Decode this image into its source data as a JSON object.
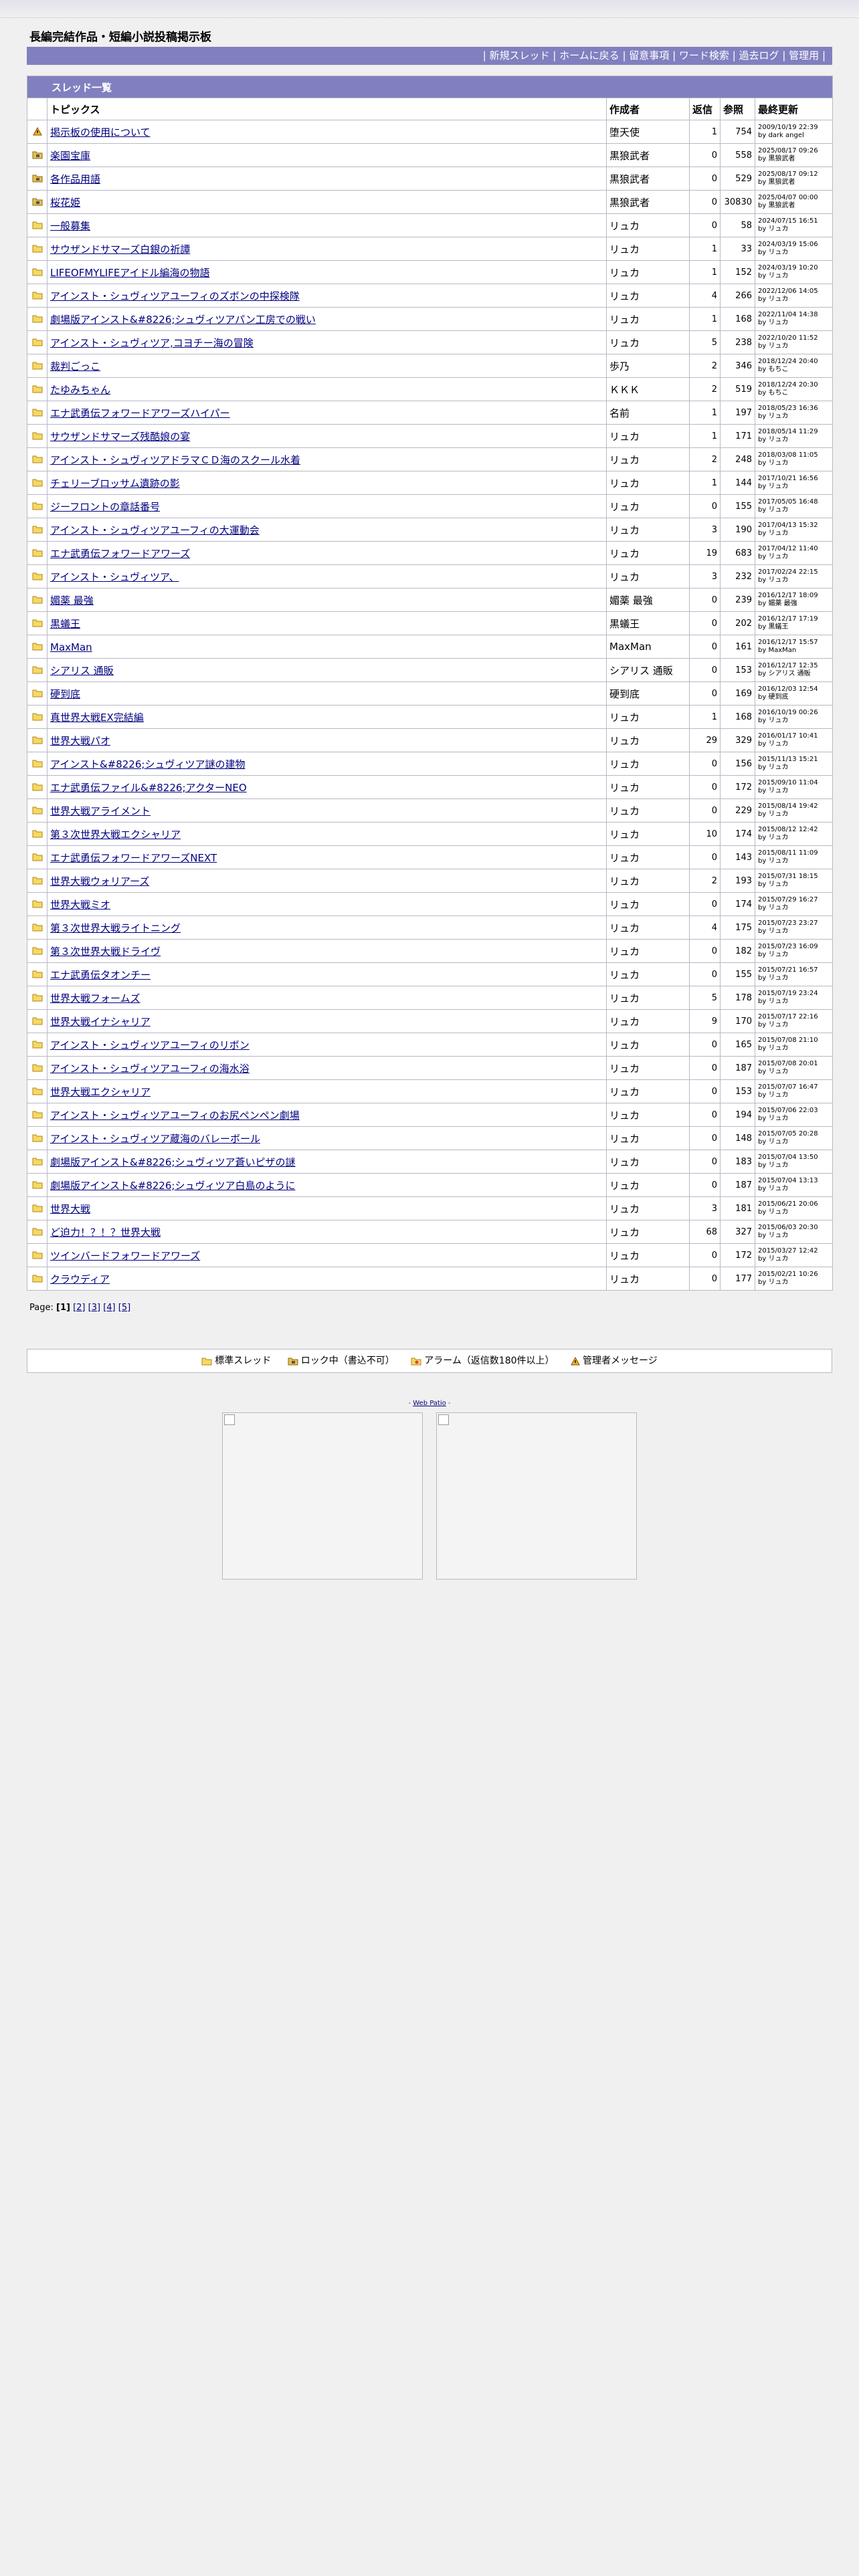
{
  "site": {
    "title": "長編完結作品・短編小説投稿掲示板",
    "menu": [
      "新規スレッド",
      "ホームに戻る",
      "留意事項",
      "ワード検索",
      "過去ログ",
      "管理用"
    ]
  },
  "table": {
    "caption": "スレッド一覧",
    "headers": [
      "トピックス",
      "作成者",
      "返信",
      "参照",
      "最終更新"
    ],
    "rows": [
      {
        "icon": "warning",
        "topic": "掲示板の使用について",
        "author": "堕天使",
        "replies": "1",
        "views": "754",
        "updated": "2009/10/19 22:39",
        "by": "by dark angel"
      },
      {
        "icon": "lock",
        "topic": "楽園宝庫",
        "author": "黒狼武者",
        "replies": "0",
        "views": "558",
        "updated": "2025/08/17 09:26",
        "by": "by 黒狼武者"
      },
      {
        "icon": "lock",
        "topic": "各作品用語",
        "author": "黒狼武者",
        "replies": "0",
        "views": "529",
        "updated": "2025/08/17 09:12",
        "by": "by 黒狼武者"
      },
      {
        "icon": "lock",
        "topic": "桜花姫",
        "author": "黒狼武者",
        "replies": "0",
        "views": "30830",
        "updated": "2025/04/07 00:00",
        "by": "by 黒狼武者"
      },
      {
        "icon": "folder",
        "topic": "一般募集",
        "author": "リュカ",
        "replies": "0",
        "views": "58",
        "updated": "2024/07/15 16:51",
        "by": "by リュカ"
      },
      {
        "icon": "folder",
        "topic": "サウザンドサマーズ白銀の祈譚",
        "author": "リュカ",
        "replies": "1",
        "views": "33",
        "updated": "2024/03/19 15:06",
        "by": "by リュカ"
      },
      {
        "icon": "folder",
        "topic": "LIFEOFMYLIFEアイドル編海の物語",
        "author": "リュカ",
        "replies": "1",
        "views": "152",
        "updated": "2024/03/19 10:20",
        "by": "by リュカ"
      },
      {
        "icon": "folder",
        "topic": "アインスト・シュヴィツアユーフィのズボンの中探検隊",
        "author": "リュカ",
        "replies": "4",
        "views": "266",
        "updated": "2022/12/06 14:05",
        "by": "by リュカ"
      },
      {
        "icon": "folder",
        "topic": "劇場版アインスト&#8226;シュヴィツアパン工房での戦い",
        "author": "リュカ",
        "replies": "1",
        "views": "168",
        "updated": "2022/11/04 14:38",
        "by": "by リュカ"
      },
      {
        "icon": "folder",
        "topic": "アインスト・シュヴィツア,コヨチー海の冒険",
        "author": "リュカ",
        "replies": "5",
        "views": "238",
        "updated": "2022/10/20 11:52",
        "by": "by リュカ"
      },
      {
        "icon": "folder",
        "topic": "裁判ごっこ",
        "author": "歩乃",
        "replies": "2",
        "views": "346",
        "updated": "2018/12/24 20:40",
        "by": "by もちこ"
      },
      {
        "icon": "folder",
        "topic": "たゆみちゃん",
        "author": "ＫＫＫ",
        "replies": "2",
        "views": "519",
        "updated": "2018/12/24 20:30",
        "by": "by もちこ"
      },
      {
        "icon": "folder",
        "topic": "エナ武勇伝フォワードアワーズハイパー",
        "author": "名前",
        "replies": "1",
        "views": "197",
        "updated": "2018/05/23 16:36",
        "by": "by リュカ"
      },
      {
        "icon": "folder",
        "topic": "サウザンドサマーズ残酷娘の宴",
        "author": "リュカ",
        "replies": "1",
        "views": "171",
        "updated": "2018/05/14 11:29",
        "by": "by リュカ"
      },
      {
        "icon": "folder",
        "topic": "アインスト・シュヴィツアドラマＣＤ海のスクール水着",
        "author": "リュカ",
        "replies": "2",
        "views": "248",
        "updated": "2018/03/08 11:05",
        "by": "by リュカ"
      },
      {
        "icon": "folder",
        "topic": "チェリーブロッサム遺跡の影",
        "author": "リュカ",
        "replies": "1",
        "views": "144",
        "updated": "2017/10/21 16:56",
        "by": "by リュカ"
      },
      {
        "icon": "folder",
        "topic": "ジーフロントの章話番号",
        "author": "リュカ",
        "replies": "0",
        "views": "155",
        "updated": "2017/05/05 16:48",
        "by": "by リュカ"
      },
      {
        "icon": "folder",
        "topic": "アインスト・シュヴィツアユーフィの大運動会",
        "author": "リュカ",
        "replies": "3",
        "views": "190",
        "updated": "2017/04/13 15:32",
        "by": "by リュカ"
      },
      {
        "icon": "folder",
        "topic": "エナ武勇伝フォワードアワーズ",
        "author": "リュカ",
        "replies": "19",
        "views": "683",
        "updated": "2017/04/12 11:40",
        "by": "by リュカ"
      },
      {
        "icon": "folder",
        "topic": "アインスト・シュヴィツア、",
        "author": "リュカ",
        "replies": "3",
        "views": "232",
        "updated": "2017/02/24 22:15",
        "by": "by リュカ"
      },
      {
        "icon": "folder",
        "topic": "媚薬 最強",
        "author": "媚薬 最強",
        "replies": "0",
        "views": "239",
        "updated": "2016/12/17 18:09",
        "by": "by 媚薬 最強"
      },
      {
        "icon": "folder",
        "topic": "黒蟻王",
        "author": "黒蟻王",
        "replies": "0",
        "views": "202",
        "updated": "2016/12/17 17:19",
        "by": "by 黒蟻王"
      },
      {
        "icon": "folder",
        "topic": "MaxMan",
        "author": "MaxMan",
        "replies": "0",
        "views": "161",
        "updated": "2016/12/17 15:57",
        "by": "by MaxMan"
      },
      {
        "icon": "folder",
        "topic": "シアリス 通販",
        "author": "シアリス 通販",
        "replies": "0",
        "views": "153",
        "updated": "2016/12/17 12:35",
        "by": "by シアリス 通販"
      },
      {
        "icon": "folder",
        "topic": "硬到底",
        "author": "硬到底",
        "replies": "0",
        "views": "169",
        "updated": "2016/12/03 12:54",
        "by": "by 硬到底"
      },
      {
        "icon": "folder",
        "topic": "真世界大戦EX完結編",
        "author": "リュカ",
        "replies": "1",
        "views": "168",
        "updated": "2016/10/19 00:26",
        "by": "by リュカ"
      },
      {
        "icon": "folder",
        "topic": "世界大戦パオ",
        "author": "リュカ",
        "replies": "29",
        "views": "329",
        "updated": "2016/01/17 10:41",
        "by": "by リュカ"
      },
      {
        "icon": "folder",
        "topic": "アインスト&#8226;シュヴィツア謎の建物",
        "author": "リュカ",
        "replies": "0",
        "views": "156",
        "updated": "2015/11/13 15:21",
        "by": "by リュカ"
      },
      {
        "icon": "folder",
        "topic": "エナ武勇伝ファイル&#8226;アクターNEO",
        "author": "リュカ",
        "replies": "0",
        "views": "172",
        "updated": "2015/09/10 11:04",
        "by": "by リュカ"
      },
      {
        "icon": "folder",
        "topic": "世界大戦アライメント",
        "author": "リュカ",
        "replies": "0",
        "views": "229",
        "updated": "2015/08/14 19:42",
        "by": "by リュカ"
      },
      {
        "icon": "folder",
        "topic": "第３次世界大戦エクシャリア",
        "author": "リュカ",
        "replies": "10",
        "views": "174",
        "updated": "2015/08/12 12:42",
        "by": "by リュカ"
      },
      {
        "icon": "folder",
        "topic": "エナ武勇伝フォワードアワーズNEXT",
        "author": "リュカ",
        "replies": "0",
        "views": "143",
        "updated": "2015/08/11 11:09",
        "by": "by リュカ"
      },
      {
        "icon": "folder",
        "topic": "世界大戦ウォリアーズ",
        "author": "リュカ",
        "replies": "2",
        "views": "193",
        "updated": "2015/07/31 18:15",
        "by": "by リュカ"
      },
      {
        "icon": "folder",
        "topic": "世界大戦ミオ",
        "author": "リュカ",
        "replies": "0",
        "views": "174",
        "updated": "2015/07/29 16:27",
        "by": "by リュカ"
      },
      {
        "icon": "folder",
        "topic": "第３次世界大戦ライトニング",
        "author": "リュカ",
        "replies": "4",
        "views": "175",
        "updated": "2015/07/23 23:27",
        "by": "by リュカ"
      },
      {
        "icon": "folder",
        "topic": "第３次世界大戦ドライヴ",
        "author": "リュカ",
        "replies": "0",
        "views": "182",
        "updated": "2015/07/23 16:09",
        "by": "by リュカ"
      },
      {
        "icon": "folder",
        "topic": "エナ武勇伝タオンチー",
        "author": "リュカ",
        "replies": "0",
        "views": "155",
        "updated": "2015/07/21 16:57",
        "by": "by リュカ"
      },
      {
        "icon": "folder",
        "topic": "世界大戦フォームズ",
        "author": "リュカ",
        "replies": "5",
        "views": "178",
        "updated": "2015/07/19 23:24",
        "by": "by リュカ"
      },
      {
        "icon": "folder",
        "topic": "世界大戦イナシャリア",
        "author": "リュカ",
        "replies": "9",
        "views": "170",
        "updated": "2015/07/17 22:16",
        "by": "by リュカ"
      },
      {
        "icon": "folder",
        "topic": "アインスト・シュヴィツアユーフィのリボン",
        "author": "リュカ",
        "replies": "0",
        "views": "165",
        "updated": "2015/07/08 21:10",
        "by": "by リュカ"
      },
      {
        "icon": "folder",
        "topic": "アインスト・シュヴィツアユーフィの海水浴",
        "author": "リュカ",
        "replies": "0",
        "views": "187",
        "updated": "2015/07/08 20:01",
        "by": "by リュカ"
      },
      {
        "icon": "folder",
        "topic": "世界大戦エクシャリア",
        "author": "リュカ",
        "replies": "0",
        "views": "153",
        "updated": "2015/07/07 16:47",
        "by": "by リュカ"
      },
      {
        "icon": "folder",
        "topic": "アインスト・シュヴィツアユーフィのお尻ペンペン劇場",
        "author": "リュカ",
        "replies": "0",
        "views": "194",
        "updated": "2015/07/06 22:03",
        "by": "by リュカ"
      },
      {
        "icon": "folder",
        "topic": "アインスト・シュヴィツア蔵海のバレーボール",
        "author": "リュカ",
        "replies": "0",
        "views": "148",
        "updated": "2015/07/05 20:28",
        "by": "by リュカ"
      },
      {
        "icon": "folder",
        "topic": "劇場版アインスト&#8226;シュヴィツア蒼いピザの謎",
        "author": "リュカ",
        "replies": "0",
        "views": "183",
        "updated": "2015/07/04 13:50",
        "by": "by リュカ"
      },
      {
        "icon": "folder",
        "topic": "劇場版アインスト&#8226;シュヴィツア白島のように",
        "author": "リュカ",
        "replies": "0",
        "views": "187",
        "updated": "2015/07/04 13:13",
        "by": "by リュカ"
      },
      {
        "icon": "folder",
        "topic": "世界大戦",
        "author": "リュカ",
        "replies": "3",
        "views": "181",
        "updated": "2015/06/21 20:06",
        "by": "by リュカ"
      },
      {
        "icon": "folder",
        "topic": "ど迫力！？！？世界大戦",
        "author": "リュカ",
        "replies": "68",
        "views": "327",
        "updated": "2015/06/03 20:30",
        "by": "by リュカ"
      },
      {
        "icon": "folder",
        "topic": "ツインバードフォワードアワーズ",
        "author": "リュカ",
        "replies": "0",
        "views": "172",
        "updated": "2015/03/27 12:42",
        "by": "by リュカ"
      },
      {
        "icon": "folder",
        "topic": "クラウディア",
        "author": "リュカ",
        "replies": "0",
        "views": "177",
        "updated": "2015/02/21 10:26",
        "by": "by リュカ"
      }
    ]
  },
  "pager": {
    "label": "Page:",
    "current": "[1]",
    "pages": [
      "[2]",
      "[3]",
      "[4]",
      "[5]"
    ]
  },
  "legend": {
    "normal": "標準スレッド",
    "locked": "ロック中（書込不可）",
    "alarm": "アラーム（返信数180件以上）",
    "admin": "管理者メッセージ"
  },
  "credit": {
    "prefix": "- ",
    "link": "Web Patio",
    "suffix": " -"
  },
  "colors": {
    "accent": "#8080c0",
    "link": "#000080",
    "border": "#b8b8c8",
    "page_bg": "#f0f0f0"
  }
}
